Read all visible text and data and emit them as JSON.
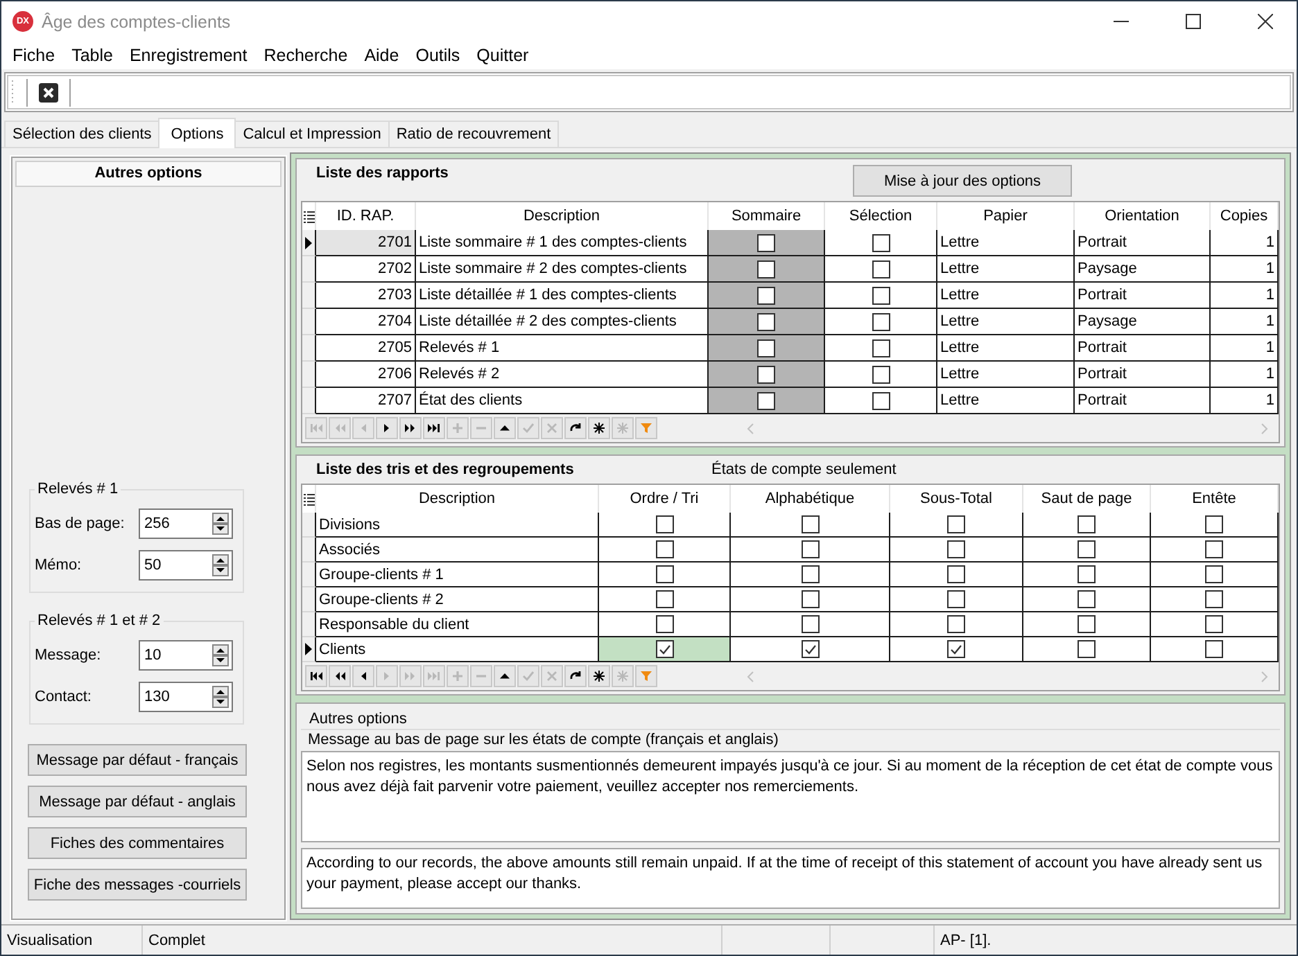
{
  "window": {
    "logo": "DX",
    "title": "Âge des comptes-clients"
  },
  "menu": [
    "Fiche",
    "Table",
    "Enregistrement",
    "Recherche",
    "Aide",
    "Outils",
    "Quitter"
  ],
  "tabs": [
    {
      "label": "Sélection des clients",
      "selected": false
    },
    {
      "label": "Options",
      "selected": true
    },
    {
      "label": "Calcul et Impression",
      "selected": false
    },
    {
      "label": "Ratio de recouvrement",
      "selected": false
    }
  ],
  "left_panel": {
    "title": "Autres options",
    "groups": [
      {
        "title": "Relevés # 1",
        "fields": [
          {
            "label": "Bas de page:",
            "value": "256"
          },
          {
            "label": "Mémo:",
            "value": "50"
          }
        ]
      },
      {
        "title": "Relevés # 1 et # 2",
        "fields": [
          {
            "label": "Message:",
            "value": "10"
          },
          {
            "label": "Contact:",
            "value": "130"
          }
        ]
      }
    ],
    "buttons": [
      "Message par défaut - français",
      "Message par défaut - anglais",
      "Fiches des commentaires",
      "Fiche des messages -courriels"
    ]
  },
  "reports": {
    "title": "Liste des rapports",
    "button": "Mise à jour des options",
    "active": false,
    "columns": [
      {
        "label": "ID. RAP.",
        "kind": "number",
        "current": true,
        "readonly": false
      },
      {
        "label": "Description",
        "kind": "text",
        "current": false,
        "readonly": false
      },
      {
        "label": "Sommaire",
        "kind": "check",
        "current": false,
        "readonly": true
      },
      {
        "label": "Sélection",
        "kind": "check",
        "current": false,
        "readonly": false
      },
      {
        "label": "Papier",
        "kind": "text",
        "current": false,
        "readonly": false
      },
      {
        "label": "Orientation",
        "kind": "text",
        "current": false,
        "readonly": false
      },
      {
        "label": "Copies",
        "kind": "number",
        "current": false,
        "readonly": false
      }
    ],
    "rows": [
      {
        "selected": true,
        "cells": [
          "2701",
          "Liste sommaire # 1 des comptes-clients",
          false,
          false,
          "Lettre",
          "Portrait",
          "1"
        ]
      },
      {
        "selected": false,
        "cells": [
          "2702",
          "Liste sommaire # 2 des comptes-clients",
          false,
          false,
          "Lettre",
          "Paysage",
          "1"
        ]
      },
      {
        "selected": false,
        "cells": [
          "2703",
          "Liste détaillée # 1 des comptes-clients",
          false,
          false,
          "Lettre",
          "Portrait",
          "1"
        ]
      },
      {
        "selected": false,
        "cells": [
          "2704",
          "Liste détaillée # 2 des comptes-clients",
          false,
          false,
          "Lettre",
          "Paysage",
          "1"
        ]
      },
      {
        "selected": false,
        "cells": [
          "2705",
          "Relevés # 1",
          false,
          false,
          "Lettre",
          "Portrait",
          "1"
        ]
      },
      {
        "selected": false,
        "cells": [
          "2706",
          "Relevés # 2",
          false,
          false,
          "Lettre",
          "Portrait",
          "1"
        ]
      },
      {
        "selected": false,
        "cells": [
          "2707",
          "État des clients",
          false,
          false,
          "Lettre",
          "Portrait",
          "1"
        ]
      }
    ],
    "navigator": [
      {
        "kind": "first",
        "disabled": true
      },
      {
        "kind": "prior",
        "disabled": true
      },
      {
        "kind": "prev",
        "disabled": true
      },
      {
        "kind": "next",
        "disabled": false
      },
      {
        "kind": "next_page",
        "disabled": false
      },
      {
        "kind": "last",
        "disabled": false
      },
      {
        "kind": "insert",
        "disabled": true
      },
      {
        "kind": "delete",
        "disabled": true
      },
      {
        "kind": "edit",
        "disabled": false
      },
      {
        "kind": "post",
        "disabled": true
      },
      {
        "kind": "cancel",
        "disabled": true
      },
      {
        "kind": "refresh",
        "disabled": false
      },
      {
        "kind": "mark",
        "disabled": false
      },
      {
        "kind": "unmark",
        "disabled": true
      },
      {
        "kind": "filter",
        "disabled": false
      }
    ]
  },
  "sort_list": {
    "title": "Liste des tris et des regroupements",
    "note": "États de compte seulement",
    "active": true,
    "columns": [
      {
        "label": "Description",
        "kind": "text",
        "current": false,
        "readonly": false
      },
      {
        "label": "Ordre / Tri",
        "kind": "check",
        "current": true,
        "readonly": false
      },
      {
        "label": "Alphabétique",
        "kind": "check",
        "current": false,
        "readonly": false
      },
      {
        "label": "Sous-Total",
        "kind": "check",
        "current": false,
        "readonly": false
      },
      {
        "label": "Saut de page",
        "kind": "check",
        "current": false,
        "readonly": false
      },
      {
        "label": "Entête",
        "kind": "check",
        "current": false,
        "readonly": false
      }
    ],
    "rows": [
      {
        "selected": false,
        "cells": [
          "Divisions",
          false,
          false,
          false,
          false,
          false
        ]
      },
      {
        "selected": false,
        "cells": [
          "Associés",
          false,
          false,
          false,
          false,
          false
        ]
      },
      {
        "selected": false,
        "cells": [
          "Groupe-clients # 1",
          false,
          false,
          false,
          false,
          false
        ]
      },
      {
        "selected": false,
        "cells": [
          "Groupe-clients # 2",
          false,
          false,
          false,
          false,
          false
        ]
      },
      {
        "selected": false,
        "cells": [
          "Responsable du client",
          false,
          false,
          false,
          false,
          false
        ]
      },
      {
        "selected": true,
        "cells": [
          "Clients",
          true,
          true,
          true,
          false,
          false
        ]
      }
    ],
    "navigator": [
      {
        "kind": "first",
        "disabled": false
      },
      {
        "kind": "prior",
        "disabled": false
      },
      {
        "kind": "prev",
        "disabled": false
      },
      {
        "kind": "next",
        "disabled": true
      },
      {
        "kind": "next_page",
        "disabled": true
      },
      {
        "kind": "last",
        "disabled": true
      },
      {
        "kind": "insert",
        "disabled": true
      },
      {
        "kind": "delete",
        "disabled": true
      },
      {
        "kind": "edit",
        "disabled": false
      },
      {
        "kind": "post",
        "disabled": true
      },
      {
        "kind": "cancel",
        "disabled": true
      },
      {
        "kind": "refresh",
        "disabled": false
      },
      {
        "kind": "mark",
        "disabled": false
      },
      {
        "kind": "unmark",
        "disabled": true
      },
      {
        "kind": "filter",
        "disabled": false
      }
    ]
  },
  "other_options": {
    "title": "Autres options",
    "message_group": "Message au bas de page sur les états de compte (français et anglais)",
    "message_fr": "Selon nos registres, les montants susmentionnés demeurent impayés jusqu'à ce jour. Si au moment de la réception de cet état de compte vous nous avez déjà fait parvenir votre paiement, veuillez accepter nos remerciements.",
    "message_en": "According to our records, the above amounts still remain unpaid. If at the time of receipt of this statement of account you have already sent us your payment, please accept our thanks."
  },
  "status_bar": [
    "Visualisation",
    "Complet",
    "AP- [1]."
  ]
}
